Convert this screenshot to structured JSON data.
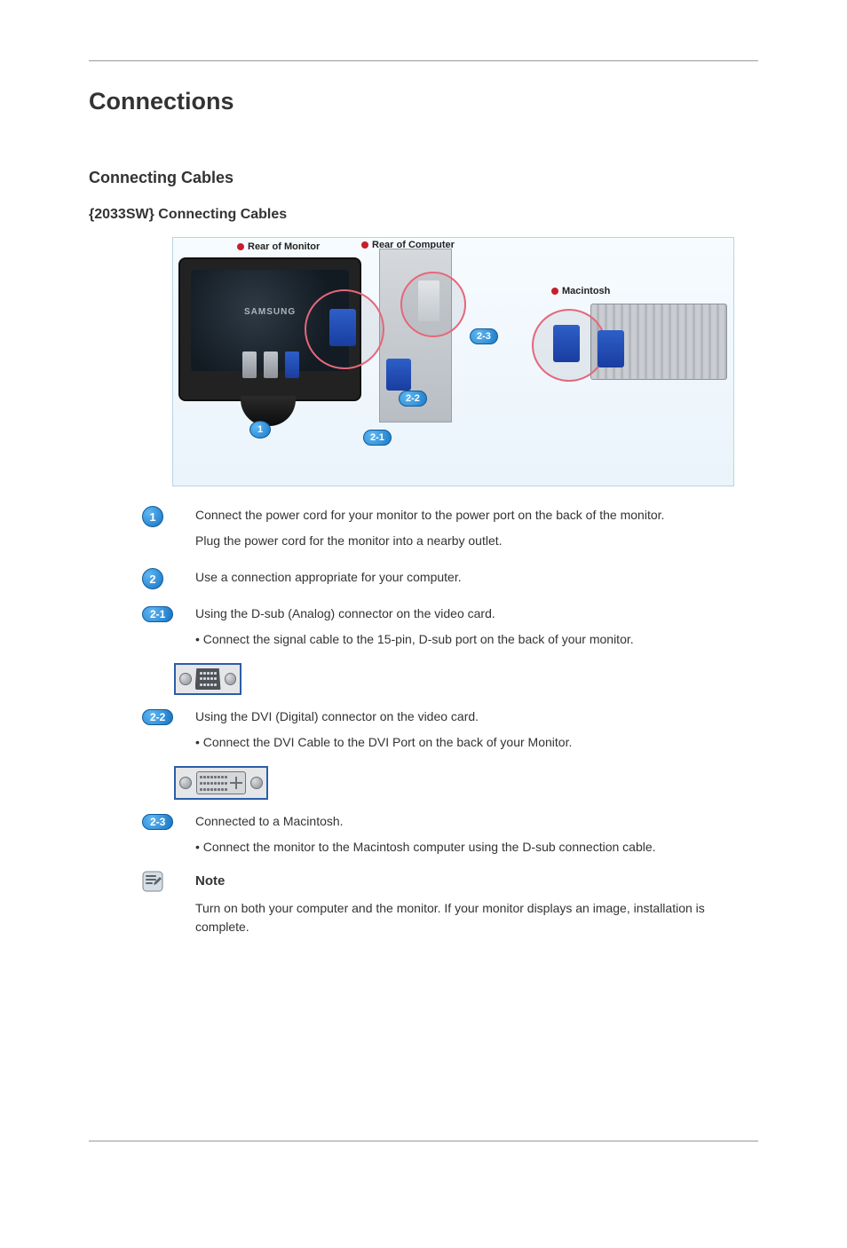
{
  "page": {
    "chapter": "Connections",
    "section": "Connecting Cables",
    "subsection": "{2033SW} Connecting Cables",
    "note_label": " Note",
    "note_body": "Turn on both your computer and the monitor. If your monitor displays an image, installation is complete."
  },
  "hero": {
    "label_monitor": "Rear of Monitor",
    "label_computer": "Rear of Computer",
    "label_mac": "Macintosh",
    "samsung": "SAMSUNG",
    "b1": "1",
    "b21": "2-1",
    "b22": "2-2",
    "b23": "2-3"
  },
  "steps": {
    "s1_icon": "1",
    "s1_p1": "Connect the power cord for your monitor to the power port on the back of the monitor.",
    "s1_p2": "Plug the power cord for the monitor into a nearby outlet.",
    "s2_icon": "2",
    "s2_p1": "Use a connection appropriate for your computer.",
    "s21_icon": "2-1",
    "s21_p1": "Using the D-sub (Analog) connector on the video card.",
    "s21_p2": "• Connect the signal cable to the 15-pin, D-sub port on the back of your monitor.",
    "s22_icon": "2-2",
    "s22_p1": "Using the DVI (Digital) connector on the video card.",
    "s22_p2": "• Connect the DVI Cable to the DVI Port on the back of your Monitor.",
    "s23_icon": "2-3",
    "s23_p1": "Connected to a Macintosh.",
    "s23_p2": "• Connect the monitor to the Macintosh computer using the D-sub connection cable."
  }
}
